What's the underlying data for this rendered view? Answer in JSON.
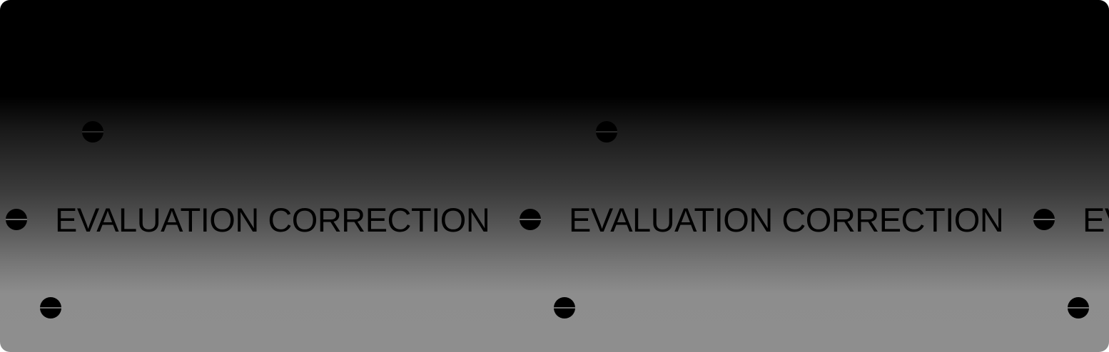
{
  "banner": {
    "repeat_text": "EVALUATION CORRECTION",
    "partial_text": "EV"
  },
  "colors": {
    "top": "#000000",
    "bottom": "#8e8e8e",
    "text": "#000000",
    "screw": "#000000"
  }
}
